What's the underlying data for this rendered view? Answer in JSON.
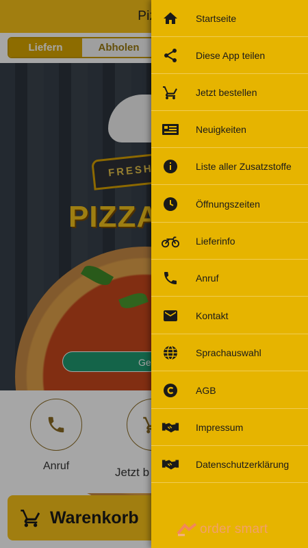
{
  "app": {
    "title": "Pizza",
    "tabs": [
      "Liefern",
      "Abholen"
    ],
    "open_status": "Geö",
    "actions": [
      {
        "label": "Anruf",
        "icon": "phone-icon"
      },
      {
        "label": "Jetzt b",
        "icon": "cart-icon"
      }
    ],
    "cart_label": "Warenkorb",
    "hero": {
      "badge_text": "FRESH",
      "logo_text": "PIZZA"
    }
  },
  "drawer": {
    "items": [
      {
        "label": "Startseite",
        "icon": "home-icon"
      },
      {
        "label": "Diese App teilen",
        "icon": "share-icon"
      },
      {
        "label": "Jetzt bestellen",
        "icon": "cart-icon"
      },
      {
        "label": "Neuigkeiten",
        "icon": "news-icon"
      },
      {
        "label": "Liste aller Zusatzstoffe",
        "icon": "info-icon"
      },
      {
        "label": "Öffnungszeiten",
        "icon": "clock-icon"
      },
      {
        "label": "Lieferinfo",
        "icon": "motorcycle-icon"
      },
      {
        "label": "Anruf",
        "icon": "phone-icon"
      },
      {
        "label": "Kontakt",
        "icon": "mail-icon"
      },
      {
        "label": "Sprachauswahl",
        "icon": "globe-icon"
      },
      {
        "label": "AGB",
        "icon": "copyright-icon"
      },
      {
        "label": "Impressum",
        "icon": "handshake-icon"
      },
      {
        "label": "Datenschutzerklärung",
        "icon": "handshake-icon"
      }
    ],
    "brand": "order smart"
  },
  "colors": {
    "topbar": "#f7c21a",
    "drawer": "#e6b400",
    "accent": "#d9a600",
    "open_pill": "#1f9a70"
  }
}
